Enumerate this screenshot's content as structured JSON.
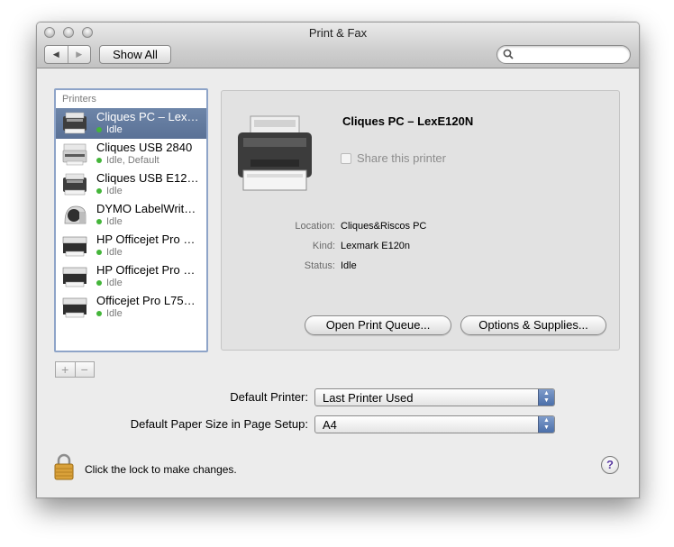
{
  "window": {
    "title": "Print & Fax"
  },
  "toolbar": {
    "back_icon": "◀",
    "forward_icon": "▶",
    "show_all": "Show All",
    "search_placeholder": ""
  },
  "printers": {
    "header": "Printers",
    "items": [
      {
        "name": "Cliques PC – Lex…",
        "status": "Idle",
        "selected": true,
        "icon": "laser-printer-icon"
      },
      {
        "name": "Cliques USB 2840",
        "status": "Idle, Default",
        "selected": false,
        "icon": "inkjet-printer-icon"
      },
      {
        "name": "Cliques USB E12…",
        "status": "Idle",
        "selected": false,
        "icon": "laser-printer-icon"
      },
      {
        "name": "DYMO LabelWrit…",
        "status": "Idle",
        "selected": false,
        "icon": "label-printer-icon"
      },
      {
        "name": "HP Officejet Pro …",
        "status": "Idle",
        "selected": false,
        "icon": "officejet-printer-icon"
      },
      {
        "name": "HP Officejet Pro …",
        "status": "Idle",
        "selected": false,
        "icon": "officejet-printer-icon"
      },
      {
        "name": "Officejet Pro L75…",
        "status": "Idle",
        "selected": false,
        "icon": "officejet-printer-icon"
      }
    ],
    "add": "+",
    "remove": "−"
  },
  "detail": {
    "name": "Cliques PC – LexE120N",
    "share_label": "Share this printer",
    "location_label": "Location:",
    "location": "Cliques&Riscos PC",
    "kind_label": "Kind:",
    "kind": "Lexmark E120n",
    "status_label": "Status:",
    "status": "Idle",
    "open_queue": "Open Print Queue...",
    "options": "Options & Supplies..."
  },
  "defaults": {
    "printer_label": "Default Printer:",
    "printer_value": "Last Printer Used",
    "paper_label": "Default Paper Size in Page Setup:",
    "paper_value": "A4"
  },
  "footer": {
    "lock_text": "Click the lock to make changes.",
    "help": "?"
  },
  "colors": {
    "selection": "#5a7196",
    "status_dot": "#44b53a",
    "accent": "#4b6fa9"
  }
}
